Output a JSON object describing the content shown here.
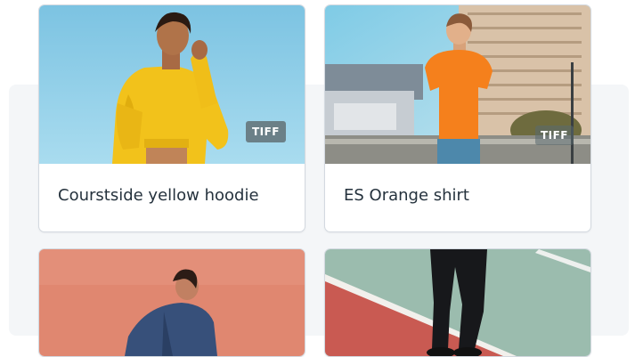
{
  "products": [
    {
      "title": "Courstside yellow hoodie",
      "badge": "TIFF"
    },
    {
      "title": "ES Orange shirt",
      "badge": "TIFF"
    },
    {
      "title": ""
    },
    {
      "title": ""
    }
  ]
}
